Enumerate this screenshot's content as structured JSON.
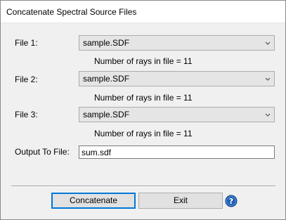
{
  "window": {
    "title": "Concatenate Spectral Source Files"
  },
  "files": [
    {
      "label": "File 1:",
      "value": "sample.SDF",
      "rays_text": "Number of rays in file = 11"
    },
    {
      "label": "File 2:",
      "value": "sample.SDF",
      "rays_text": "Number of rays in file = 11"
    },
    {
      "label": "File 3:",
      "value": "sample.SDF",
      "rays_text": "Number of rays in file = 11"
    }
  ],
  "output": {
    "label": "Output To File:",
    "value": "sum.sdf"
  },
  "buttons": {
    "concatenate": "Concatenate",
    "exit": "Exit"
  },
  "icons": {
    "dropdown": "chevron-down-icon",
    "help": "help-icon"
  },
  "colors": {
    "accent": "#0078d7",
    "help_blue": "#1e5fb4"
  }
}
